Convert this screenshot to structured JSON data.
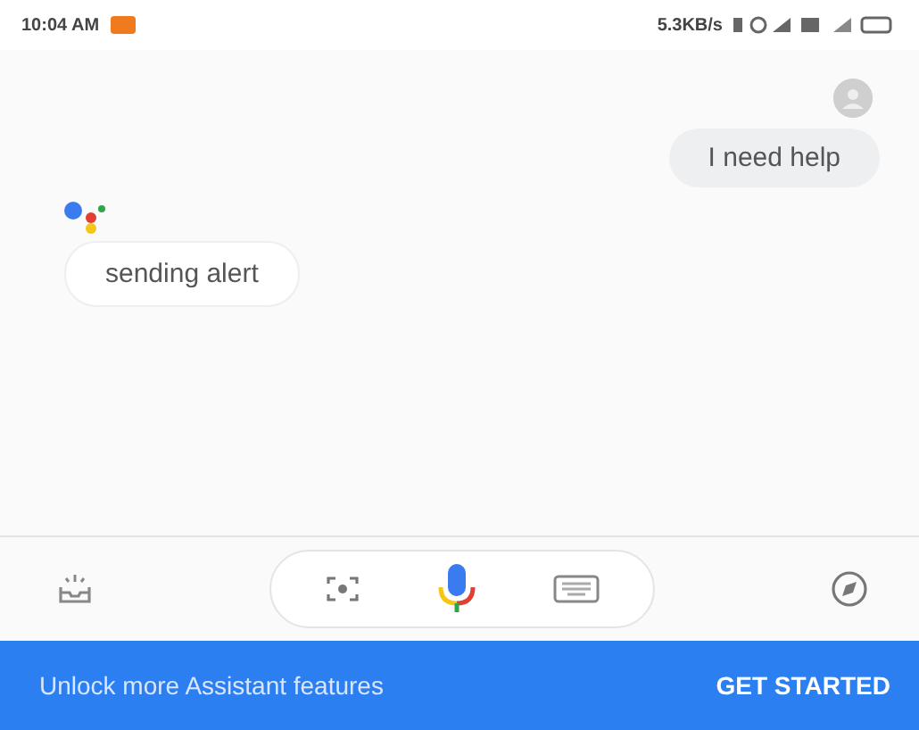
{
  "status_bar": {
    "time": "10:04 AM",
    "speed": "5.3KB/s"
  },
  "messages": [
    {
      "kind": "user",
      "text": "I need help"
    },
    {
      "kind": "assistant",
      "text": "sending alert"
    }
  ],
  "banner": {
    "text": "Unlock more Assistant features",
    "action": "GET STARTED"
  }
}
